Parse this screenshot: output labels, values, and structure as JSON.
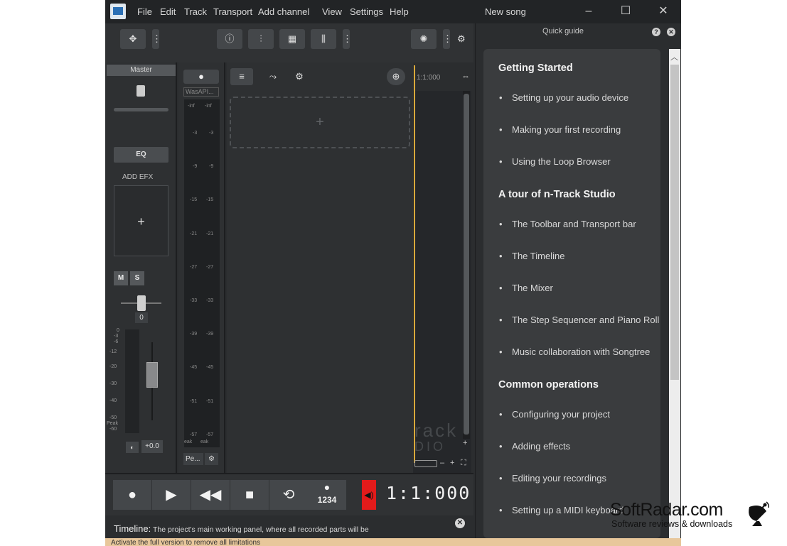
{
  "menubar": {
    "items": [
      "File",
      "Edit",
      "Track",
      "Transport",
      "Add channel",
      "View",
      "Settings",
      "Help"
    ],
    "title": "New song"
  },
  "master": {
    "label": "Master",
    "eq_label": "EQ",
    "add_efx_label": "ADD EFX",
    "add_symbol": "+",
    "mute_label": "M",
    "solo_label": "S",
    "volume_value": "0",
    "gain_value": "+0.0",
    "meter_scale": [
      "0",
      "-3",
      "-6",
      "-12",
      "-20",
      "-30",
      "-40",
      "-50",
      "Peak",
      "-60"
    ]
  },
  "track": {
    "device_label": "WasAPI...",
    "meter_ticks": [
      "-inf",
      "-3",
      "-9",
      "-15",
      "-21",
      "-27",
      "-33",
      "-39",
      "-45",
      "-51",
      "-57"
    ],
    "peak_label": "Pe...",
    "peak_sub": "eak"
  },
  "trackarea": {
    "add_symbol": "+"
  },
  "timeline": {
    "ruler_text": "1:1:000",
    "watermark_top": "rack",
    "watermark_bottom": "DIO"
  },
  "transport": {
    "count_in_label": "1234",
    "time_display": "1:1:000"
  },
  "infobar": {
    "title": "Timeline:",
    "text": "The project's main working panel, where all recorded parts will be",
    "activate_text": "Activate the full version to remove all limitations"
  },
  "quick_guide": {
    "title": "Quick guide",
    "sections": [
      {
        "heading": "Getting Started",
        "items": [
          "Setting up your audio device",
          "Making your first recording",
          "Using the Loop Browser"
        ]
      },
      {
        "heading": "A tour of n-Track Studio",
        "items": [
          "The Toolbar and Transport bar",
          "The Timeline",
          "The Mixer",
          "The Step Sequencer and Piano Roll",
          "Music collaboration with Songtree"
        ]
      },
      {
        "heading": "Common operations",
        "items": [
          "Configuring your project",
          "Adding effects",
          "Editing your recordings",
          "Setting up a MIDI keyboard"
        ]
      }
    ]
  },
  "watermark": {
    "brand": "SoftRadar.com",
    "tagline": "Software reviews & downloads"
  },
  "colors": {
    "background": "#2b2d2f",
    "accent_cursor": "#d9a93b",
    "record_red": "#e21b1b",
    "activate_bar": "#e8c79b"
  }
}
